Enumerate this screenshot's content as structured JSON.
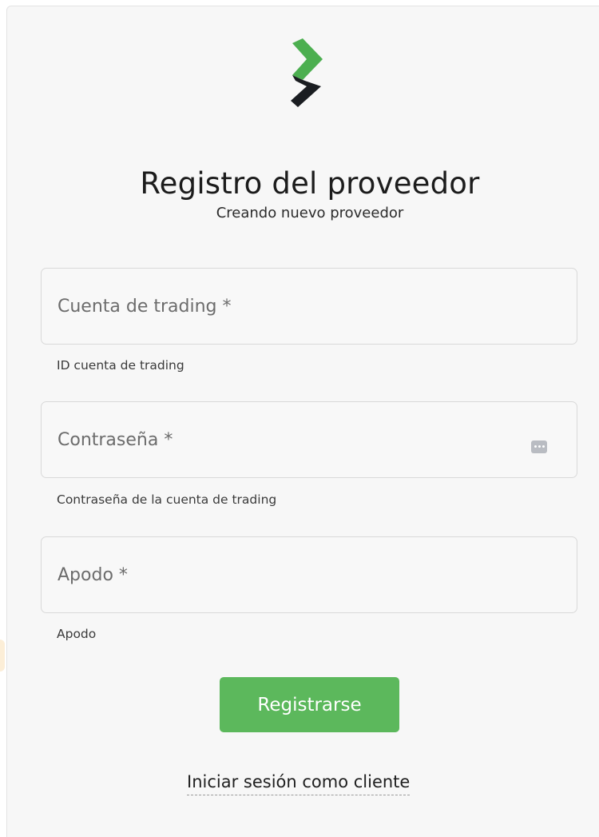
{
  "header": {
    "title": "Registro del proveedor",
    "subtitle": "Creando nuevo proveedor"
  },
  "form": {
    "trading_account": {
      "placeholder": "Cuenta de trading *",
      "value": "",
      "helper": "ID cuenta de trading"
    },
    "password": {
      "placeholder": "Contraseña *",
      "value": "",
      "helper": "Contraseña de la cuenta de trading",
      "icon": "password-manager-icon"
    },
    "nickname": {
      "placeholder": "Apodo *",
      "value": "",
      "helper": "Apodo"
    },
    "submit_label": "Registrarse"
  },
  "footer": {
    "client_login_link": "Iniciar sesión como cliente"
  },
  "colors": {
    "accent_green": "#5cb85c",
    "logo_green": "#4caf50",
    "logo_dark": "#1a1d21",
    "background": "#f7f7f7"
  }
}
